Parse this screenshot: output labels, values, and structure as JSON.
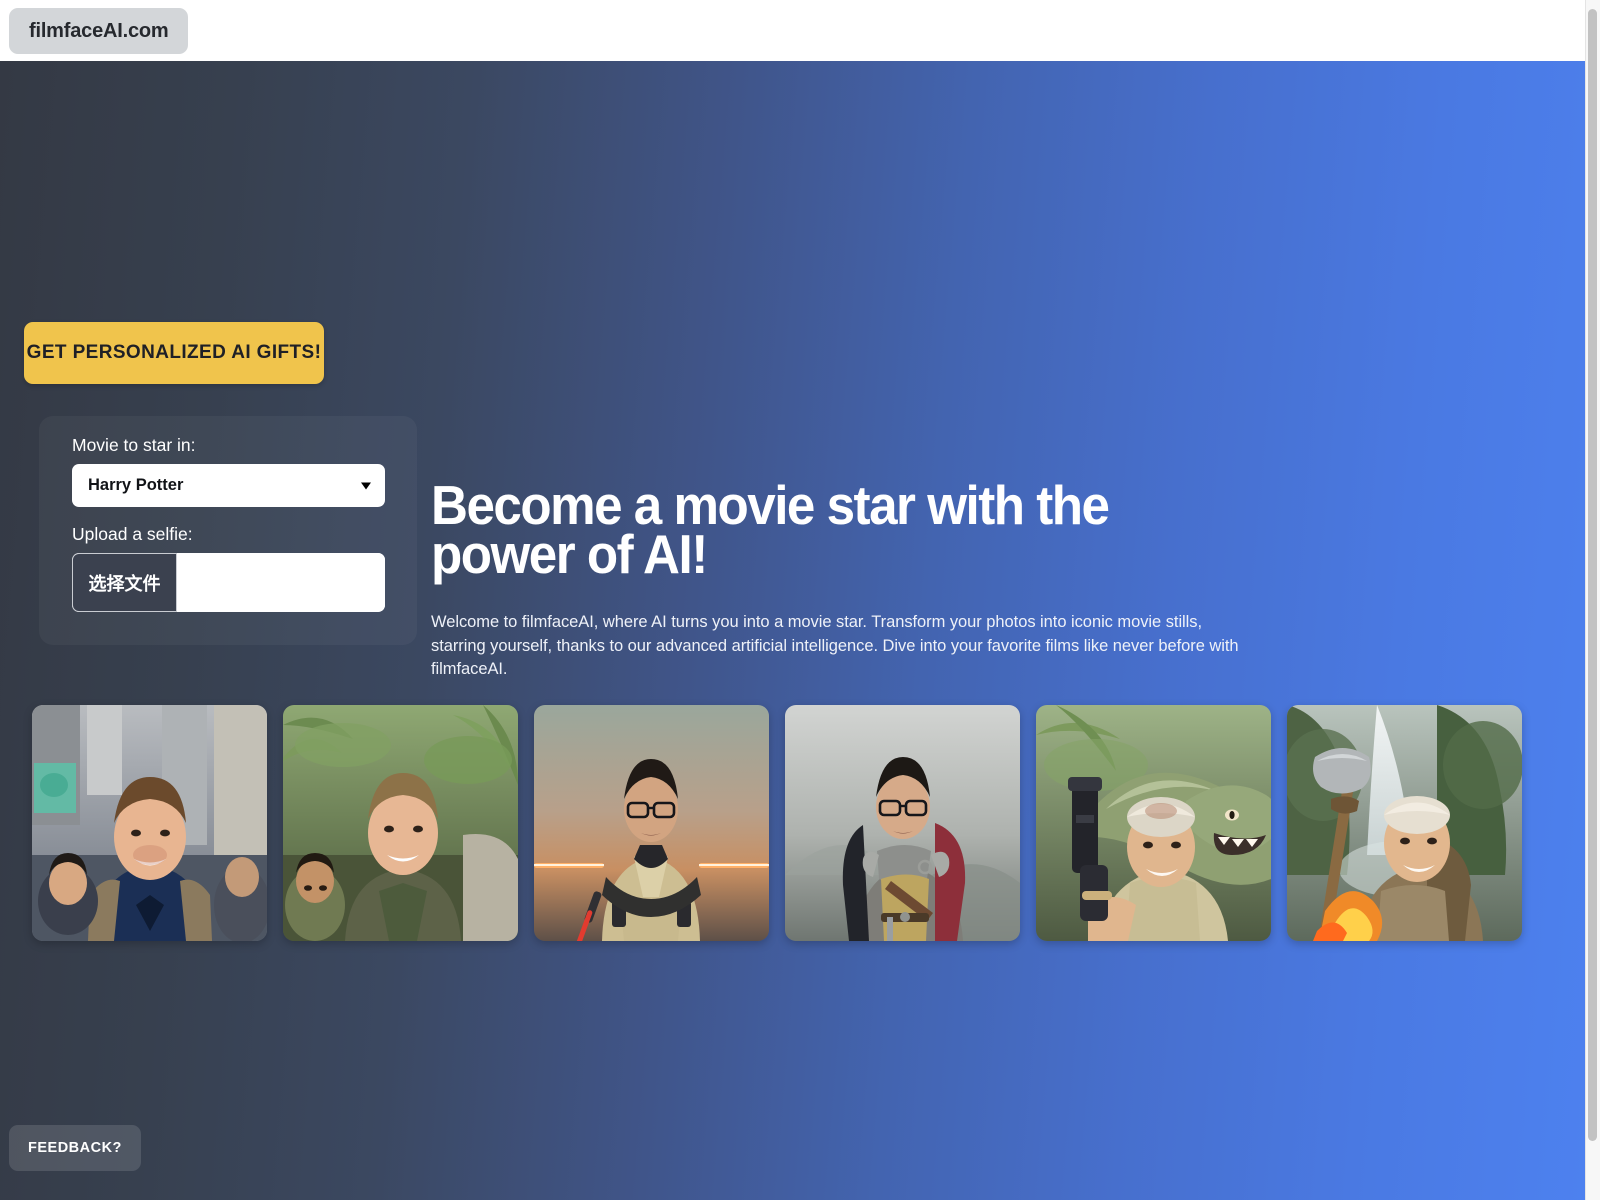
{
  "browser": {
    "tab_label": "filmfaceAI.com"
  },
  "cta": {
    "gift_button": "GET PERSONALIZED AI GIFTS!"
  },
  "form": {
    "movie_label": "Movie to star in:",
    "movie_value": "Harry Potter",
    "movie_options": [
      "Harry Potter"
    ],
    "upload_label": "Upload a selfie:",
    "file_button": "选择文件",
    "file_name": ""
  },
  "hero": {
    "headline": "Become a movie star with the power of AI!",
    "paragraph": "Welcome to filmfaceAI, where AI turns you into a movie star. Transform your photos into iconic movie stills, starring yourself, thanks to our advanced artificial intelligence. Dive into your favorite films like never before with filmfaceAI."
  },
  "gallery": {
    "items": [
      {
        "alt": "man-as-spiderman-in-city-street"
      },
      {
        "alt": "man-in-jungle-expedition-scene"
      },
      {
        "alt": "man-as-jedi-with-lightsaber"
      },
      {
        "alt": "man-as-armored-knight-with-cloak"
      },
      {
        "alt": "man-with-dinosaur-holding-flashlight"
      },
      {
        "alt": "man-as-wizard-with-staff-at-waterfall"
      }
    ]
  },
  "footer": {
    "feedback_button": "FEEDBACK?"
  },
  "colors": {
    "accent_yellow": "#f0c44c",
    "gradient_left": "#343944",
    "gradient_right": "#4d81ef",
    "file_button_dark": "#3b414f"
  }
}
